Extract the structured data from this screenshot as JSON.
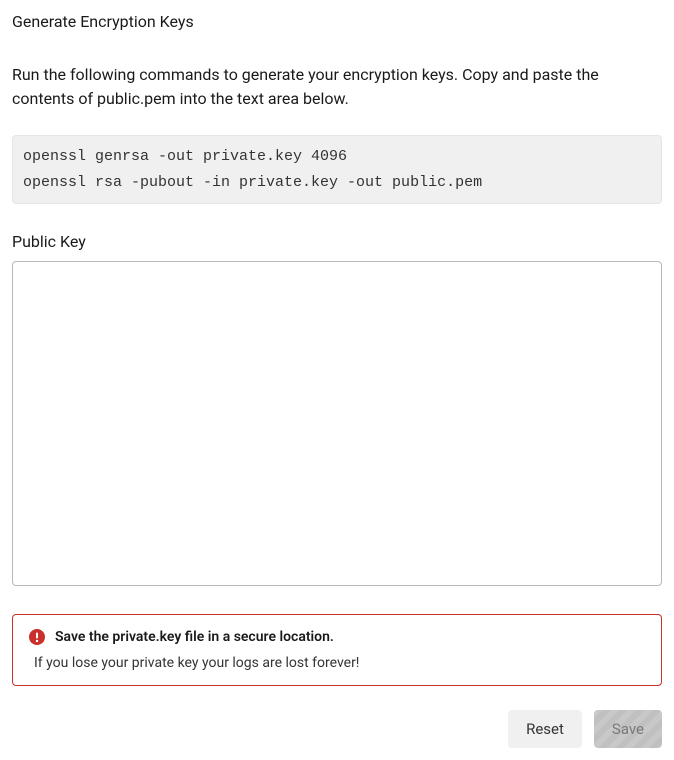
{
  "title": "Generate Encryption Keys",
  "description": "Run the following commands to generate your encryption keys. Copy and paste the contents of public.pem into the text area below.",
  "code": "openssl genrsa -out private.key 4096\nopenssl rsa -pubout -in private.key -out public.pem",
  "public_key": {
    "label": "Public Key",
    "value": ""
  },
  "alert": {
    "title": "Save the private.key file in a secure location.",
    "body": "If you lose your private key your logs are lost forever!",
    "icon_color": "#c9302c"
  },
  "buttons": {
    "reset": "Reset",
    "save": "Save"
  }
}
